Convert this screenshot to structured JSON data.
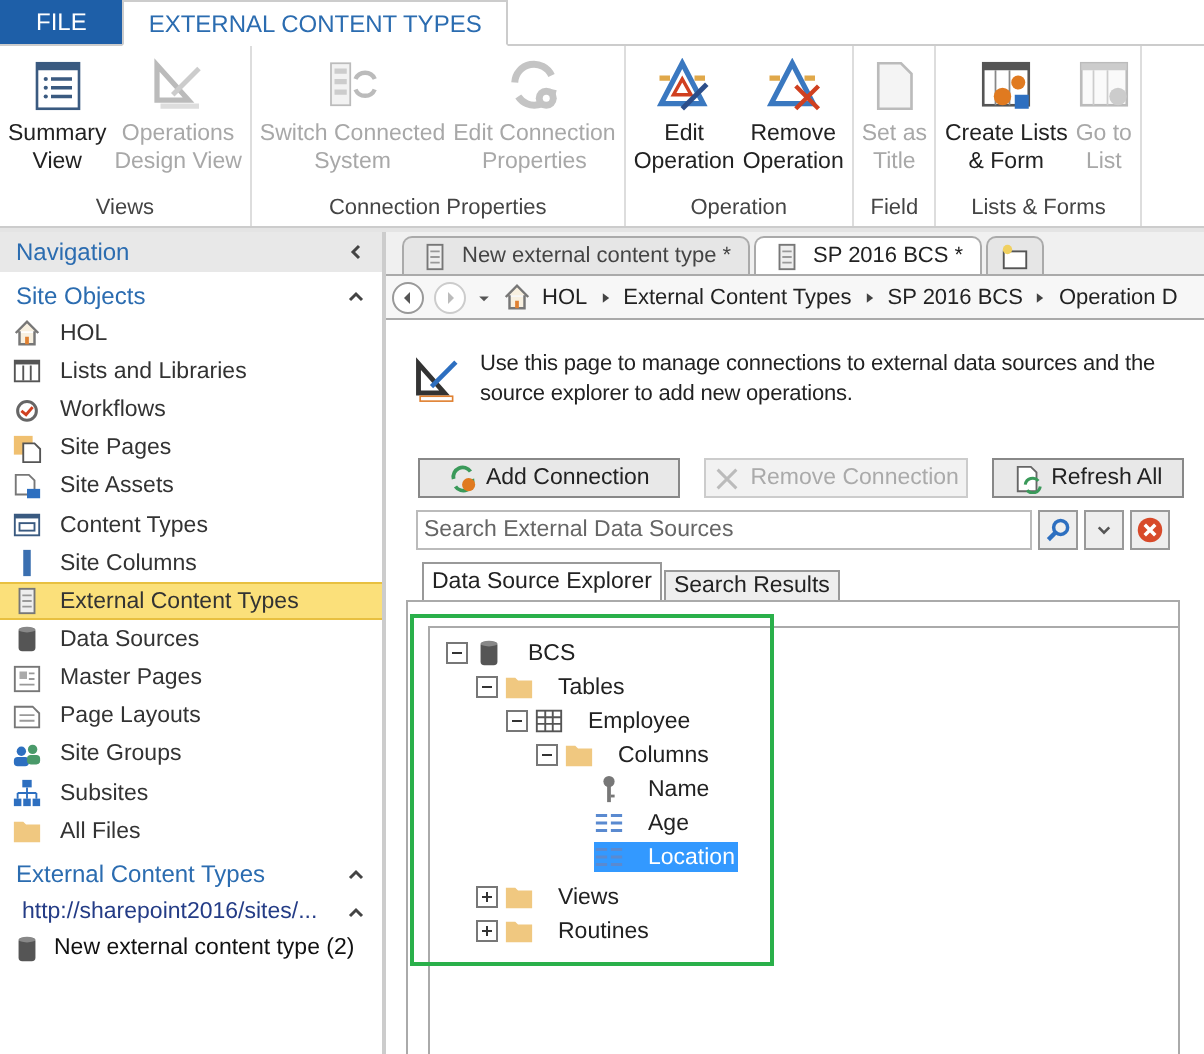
{
  "ribbon_tabs": [
    {
      "label": "FILE",
      "kind": "file",
      "selected": false
    },
    {
      "label": "EXTERNAL CONTENT TYPES",
      "kind": "tab",
      "selected": true
    }
  ],
  "ribbon_groups": [
    {
      "label": "Views",
      "buttons": [
        {
          "lines": [
            "Summary",
            "View"
          ],
          "disabled": false
        },
        {
          "lines": [
            "Operations",
            "Design View"
          ],
          "disabled": true
        }
      ]
    },
    {
      "label": "Connection Properties",
      "buttons": [
        {
          "lines": [
            "Switch Connected",
            "System"
          ],
          "disabled": true
        },
        {
          "lines": [
            "Edit Connection",
            "Properties"
          ],
          "disabled": true
        }
      ]
    },
    {
      "label": "Operation",
      "buttons": [
        {
          "lines": [
            "Edit",
            "Operation"
          ],
          "disabled": false
        },
        {
          "lines": [
            "Remove",
            "Operation"
          ],
          "disabled": false
        }
      ]
    },
    {
      "label": "Field",
      "buttons": [
        {
          "lines": [
            "Set as",
            "Title"
          ],
          "disabled": true
        }
      ]
    },
    {
      "label": "Lists & Forms",
      "buttons": [
        {
          "lines": [
            "Create Lists",
            "& Form"
          ],
          "disabled": false
        },
        {
          "lines": [
            "Go to",
            "List"
          ],
          "disabled": true
        }
      ]
    }
  ],
  "navigation": {
    "title": "Navigation",
    "sections": [
      {
        "title": "Site Objects",
        "expanded": true,
        "items": [
          {
            "label": "HOL",
            "selected": false
          },
          {
            "label": "Lists and Libraries",
            "selected": false
          },
          {
            "label": "Workflows",
            "selected": false
          },
          {
            "label": "Site Pages",
            "selected": false
          },
          {
            "label": "Site Assets",
            "selected": false
          },
          {
            "label": "Content Types",
            "selected": false
          },
          {
            "label": "Site Columns",
            "selected": false
          },
          {
            "label": "External Content Types",
            "selected": true
          },
          {
            "label": "Data Sources",
            "selected": false
          },
          {
            "label": "Master Pages",
            "selected": false
          },
          {
            "label": "Page Layouts",
            "selected": false
          },
          {
            "label": "Site Groups",
            "selected": false
          },
          {
            "label": "Subsites",
            "selected": false
          },
          {
            "label": "All Files",
            "selected": false
          }
        ]
      },
      {
        "title": "External Content Types",
        "expanded": true,
        "subheader": "http://sharepoint2016/sites/...",
        "items": [
          {
            "label": "New external content type (2)",
            "selected": false
          }
        ]
      }
    ]
  },
  "doc_tabs": [
    {
      "label": "New external content type *",
      "selected": false
    },
    {
      "label": "SP 2016 BCS *",
      "selected": true
    }
  ],
  "breadcrumb": [
    "HOL",
    "External Content Types",
    "SP 2016 BCS",
    "Operation D"
  ],
  "description_lines": [
    "Use this page to manage connections to external data sources and the",
    "source explorer to add new operations."
  ],
  "actions": [
    {
      "label": "Add Connection",
      "disabled": false
    },
    {
      "label": "Remove Connection",
      "disabled": true
    },
    {
      "label": "Refresh All",
      "disabled": false
    }
  ],
  "search": {
    "placeholder": "Search External Data Sources"
  },
  "explorer_tabs": [
    {
      "label": "Data Source Explorer",
      "selected": true
    },
    {
      "label": "Search Results",
      "selected": false
    }
  ],
  "tree": [
    {
      "label": "BCS",
      "kind": "database",
      "expanded": true,
      "selected": false,
      "children": [
        {
          "label": "Tables",
          "kind": "folder",
          "expanded": true,
          "selected": false,
          "children": [
            {
              "label": "Employee",
              "kind": "table",
              "expanded": true,
              "selected": false,
              "children": [
                {
                  "label": "Columns",
                  "kind": "folder",
                  "expanded": true,
                  "selected": false,
                  "children": [
                    {
                      "label": "Name",
                      "kind": "key",
                      "selected": false
                    },
                    {
                      "label": "Age",
                      "kind": "column",
                      "selected": false
                    },
                    {
                      "label": "Location",
                      "kind": "column",
                      "selected": true
                    }
                  ]
                }
              ]
            }
          ]
        },
        {
          "label": "Views",
          "kind": "folder",
          "expanded": false,
          "selected": false
        },
        {
          "label": "Routines",
          "kind": "folder",
          "expanded": false,
          "selected": false
        }
      ]
    }
  ]
}
